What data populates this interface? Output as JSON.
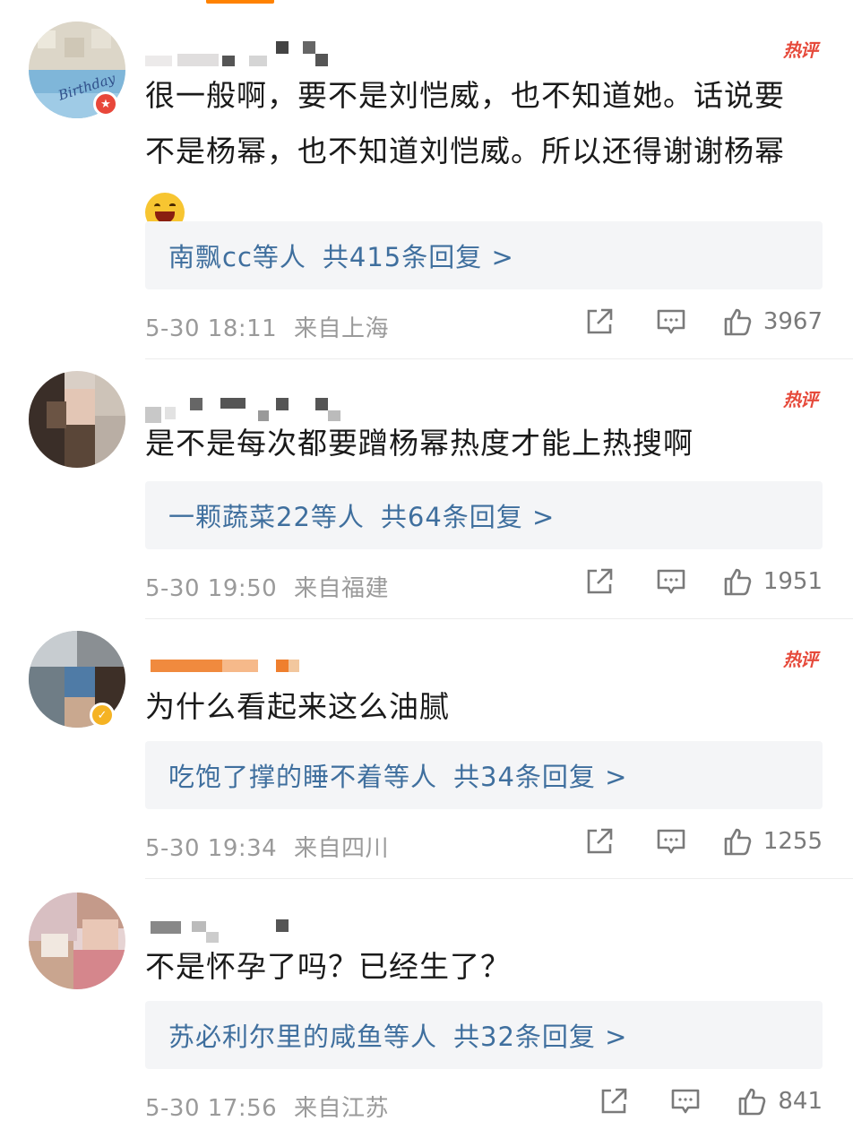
{
  "hot_label": "热评",
  "comments": [
    {
      "text": "很一般啊，要不是刘恺威，也不知道她。话说要不是杨幂，也不知道刘恺威。所以还得谢谢杨幂",
      "emoji": "laughing-face-emoji",
      "avatar_text": "Birthday",
      "reply_names": "南飘cc等人",
      "reply_count": "共415条回复 >",
      "date": "5-30 18:11",
      "location": "来自上海",
      "likes": "3967"
    },
    {
      "text": "是不是每次都要蹭杨幂热度才能上热搜啊",
      "reply_names": "一颗蔬菜22等人",
      "reply_count": "共64条回复 >",
      "date": "5-30 19:50",
      "location": "来自福建",
      "likes": "1951"
    },
    {
      "text": "为什么看起来这么油腻",
      "reply_names": "吃饱了撑的睡不着等人",
      "reply_count": "共34条回复 >",
      "date": "5-30 19:34",
      "location": "来自四川",
      "likes": "1255"
    },
    {
      "text": "不是怀孕了吗？已经生了？",
      "reply_names": "苏必利尔里的咸鱼等人",
      "reply_count": "共32条回复 >",
      "date": "5-30 17:56",
      "location": "来自江苏",
      "likes": "841"
    }
  ],
  "colors": {
    "accent": "#ff8200",
    "hot": "#e64a3b",
    "link": "#3f6f9e",
    "meta": "#9a9a9a",
    "reply_bg": "#f4f5f7"
  },
  "icons": [
    "share-icon",
    "comment-icon",
    "like-icon"
  ]
}
